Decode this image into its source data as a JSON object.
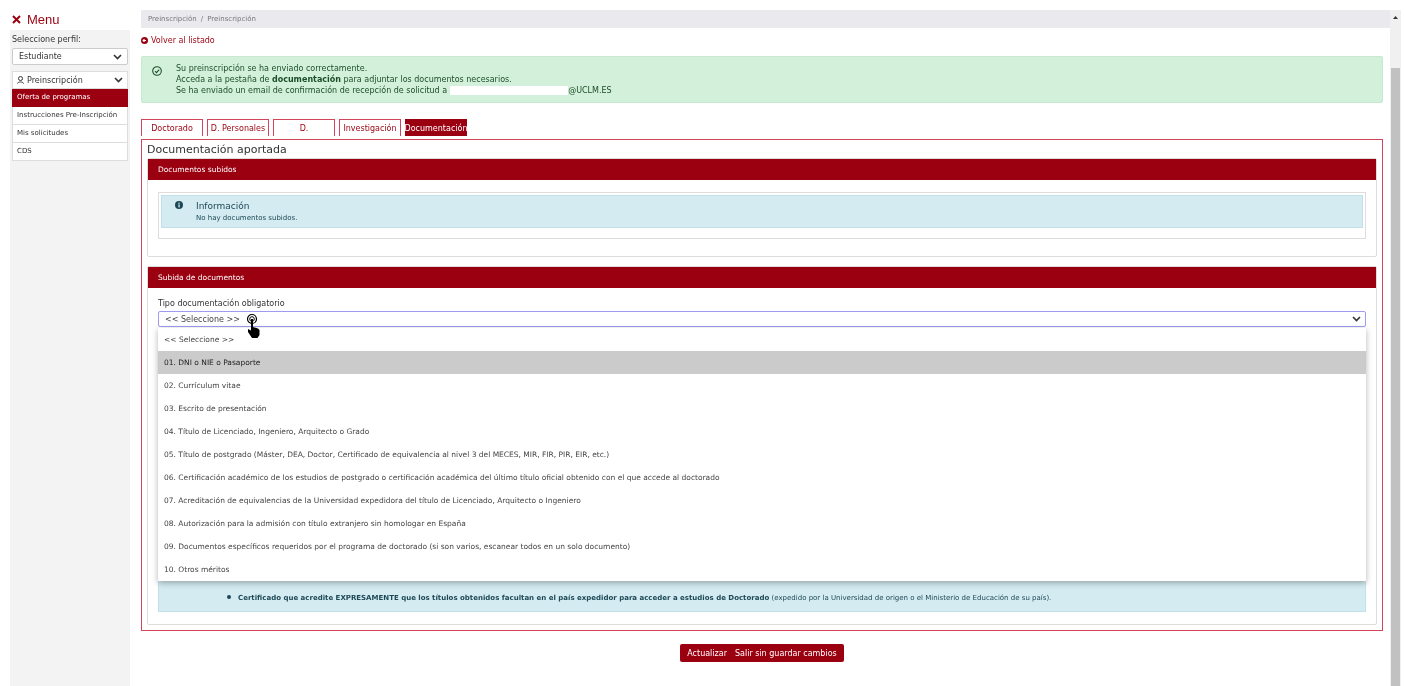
{
  "sidebar": {
    "menu_title": "Menu",
    "profile_label": "Seleccione perfil:",
    "profile_value": "Estudiante",
    "group": {
      "label": "Preinscripción",
      "expanded": true,
      "items": [
        {
          "label": "Oferta de programas",
          "selected": true
        },
        {
          "label": "Instrucciones Pre-Inscripción",
          "selected": false
        },
        {
          "label": "Mis solicitudes",
          "selected": false
        },
        {
          "label": "CDS",
          "selected": false
        }
      ]
    }
  },
  "breadcrumb": {
    "items": [
      "Preinscripción",
      "Preinscripción"
    ],
    "separator": "/"
  },
  "back_link": "Volver al listado",
  "success_alert": {
    "lines": [
      "Su preinscripción se ha enviado correctamente.",
      "Acceda a la pestaña de **documentación** para adjuntar los documentos necesarios.",
      "Se ha enviado un email de confirmación de recepción de solicitud a"
    ],
    "email_suffix": "@UCLM.ES"
  },
  "tabs": [
    {
      "label": "Doctorado",
      "selected": false
    },
    {
      "label": "D. Personales",
      "selected": false
    },
    {
      "label": "D.",
      "selected": false
    },
    {
      "label": "Investigación",
      "selected": false
    },
    {
      "label": "Documentación",
      "selected": true
    }
  ],
  "panel": {
    "title": "Documentación aportada",
    "uploaded": {
      "header": "Documentos subidos",
      "info_title": "Información",
      "info_text": "No hay documentos subidos."
    },
    "upload": {
      "header": "Subida de documentos",
      "field_label": "Tipo documentación obligatorio",
      "field_value": "<< Seleccione >>",
      "expanded": true,
      "options": [
        {
          "label": "<< Seleccione >>",
          "selected": false
        },
        {
          "label": "01. DNI o NIE o Pasaporte",
          "selected": true
        },
        {
          "label": "02. Currículum vitae",
          "selected": false
        },
        {
          "label": "03. Escrito de presentación",
          "selected": false
        },
        {
          "label": "04. Título de Licenciado, Ingeniero, Arquitecto o Grado",
          "selected": false
        },
        {
          "label": "05. Título de postgrado (Máster, DEA, Doctor, Certificado de equivalencia al nivel 3 del MECES, MIR, FIR, PIR, EIR, etc.)",
          "selected": false
        },
        {
          "label": "06. Certificación académico de los estudios de postgrado o certificación académica del último título oficial obtenido con el que accede al doctorado",
          "selected": false
        },
        {
          "label": "07. Acreditación de equivalencias de la Universidad expedidora del título de Licenciado, Arquitecto o Ingeniero",
          "selected": false
        },
        {
          "label": "08. Autorización para la admisión con título extranjero sin homologar en España",
          "selected": false
        },
        {
          "label": "09. Documentos específicos requeridos por el programa de doctorado (si son varios, escanear todos en un solo documento)",
          "selected": false
        },
        {
          "label": "10. Otros méritos",
          "selected": false
        }
      ],
      "hint": "**Certificado que acredite EXPRESAMENTE que los títulos obtenidos facultan en el país expedidor para acceder a estudios de Doctorado** (expedido por la Universidad de origen o el Ministerio de Educación de su país)."
    }
  },
  "buttons": [
    "Actualizar",
    "Salir sin guardar cambios"
  ]
}
